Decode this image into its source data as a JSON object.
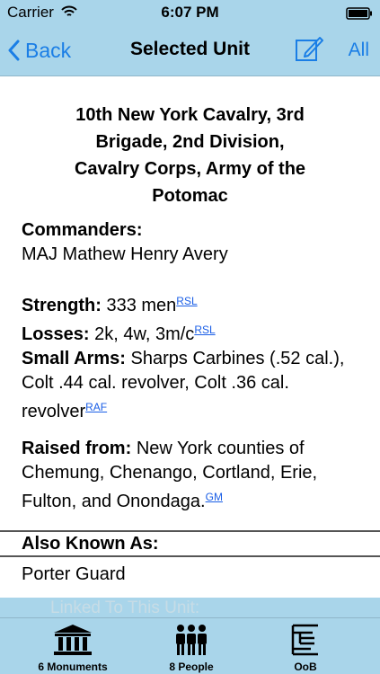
{
  "status_bar": {
    "carrier": "Carrier",
    "time": "6:07 PM"
  },
  "nav": {
    "back_label": "Back",
    "title": "Selected Unit",
    "all_label": "All",
    "accent_color": "#1a7ee6",
    "bar_color": "#a9d5ea"
  },
  "unit": {
    "title_lines": [
      "10th New York Cavalry, 3rd",
      "Brigade, 2nd Division,",
      "Cavalry Corps, Army of the",
      "Potomac"
    ],
    "commanders_label": "Commanders:",
    "commanders_value": "MAJ Mathew Henry Avery",
    "strength_label": "Strength:",
    "strength_value": "333 men",
    "strength_ref": "RSL",
    "losses_label": "Losses:",
    "losses_value": "2k, 4w, 3m/c",
    "losses_ref": "RSL",
    "small_arms_label": "Small Arms:",
    "small_arms_value": "Sharps Carbines (.52 cal.), Colt .44 cal. revolver, Colt .36 cal. revolver",
    "small_arms_ref": "RAF",
    "raised_label": "Raised from:",
    "raised_value": "New York counties of Chemung, Chenango, Cortland, Erie, Fulton, and Onondaga.",
    "raised_ref": "GM"
  },
  "aka": {
    "header": "Also Known As:",
    "value": "Porter Guard"
  },
  "linked": {
    "label": "Linked To This Unit:"
  },
  "tabs": [
    {
      "label": "6 Monuments",
      "icon": "monument-icon"
    },
    {
      "label": "8 People",
      "icon": "people-icon"
    },
    {
      "label": "OoB",
      "icon": "order-of-battle-icon"
    }
  ]
}
